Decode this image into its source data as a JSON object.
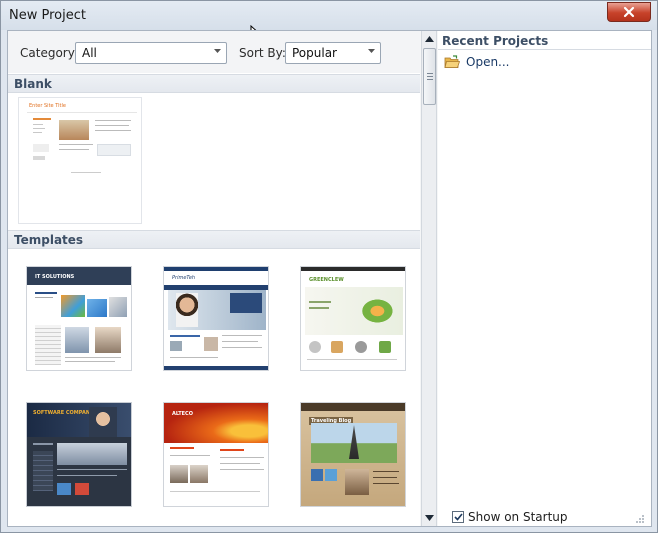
{
  "window": {
    "title": "New Project"
  },
  "filters": {
    "category_label": "Category:",
    "category_value": "All",
    "sortby_label": "Sort By:",
    "sortby_value": "Popular"
  },
  "sections": {
    "blank_title": "Blank",
    "templates_title": "Templates"
  },
  "blank_thumb": {
    "caption": "Enter Site Title"
  },
  "templates": [
    {
      "caption": "IT SOLUTIONS",
      "accent": "#2a4e86"
    },
    {
      "caption": "PrimeTeh",
      "accent": "#1f3f6f"
    },
    {
      "caption": "GREENCLEW",
      "accent": "#5a8f2b"
    },
    {
      "caption": "SOFTWARE COMPANY",
      "accent": "#1d2c44"
    },
    {
      "caption": "ALTECO",
      "accent": "#e0451a"
    },
    {
      "caption": "Traveling Blog",
      "accent": "#7a6444"
    }
  ],
  "recent": {
    "title": "Recent Projects",
    "open_label": "Open..."
  },
  "startup": {
    "label": "Show on Startup",
    "checked": true
  }
}
